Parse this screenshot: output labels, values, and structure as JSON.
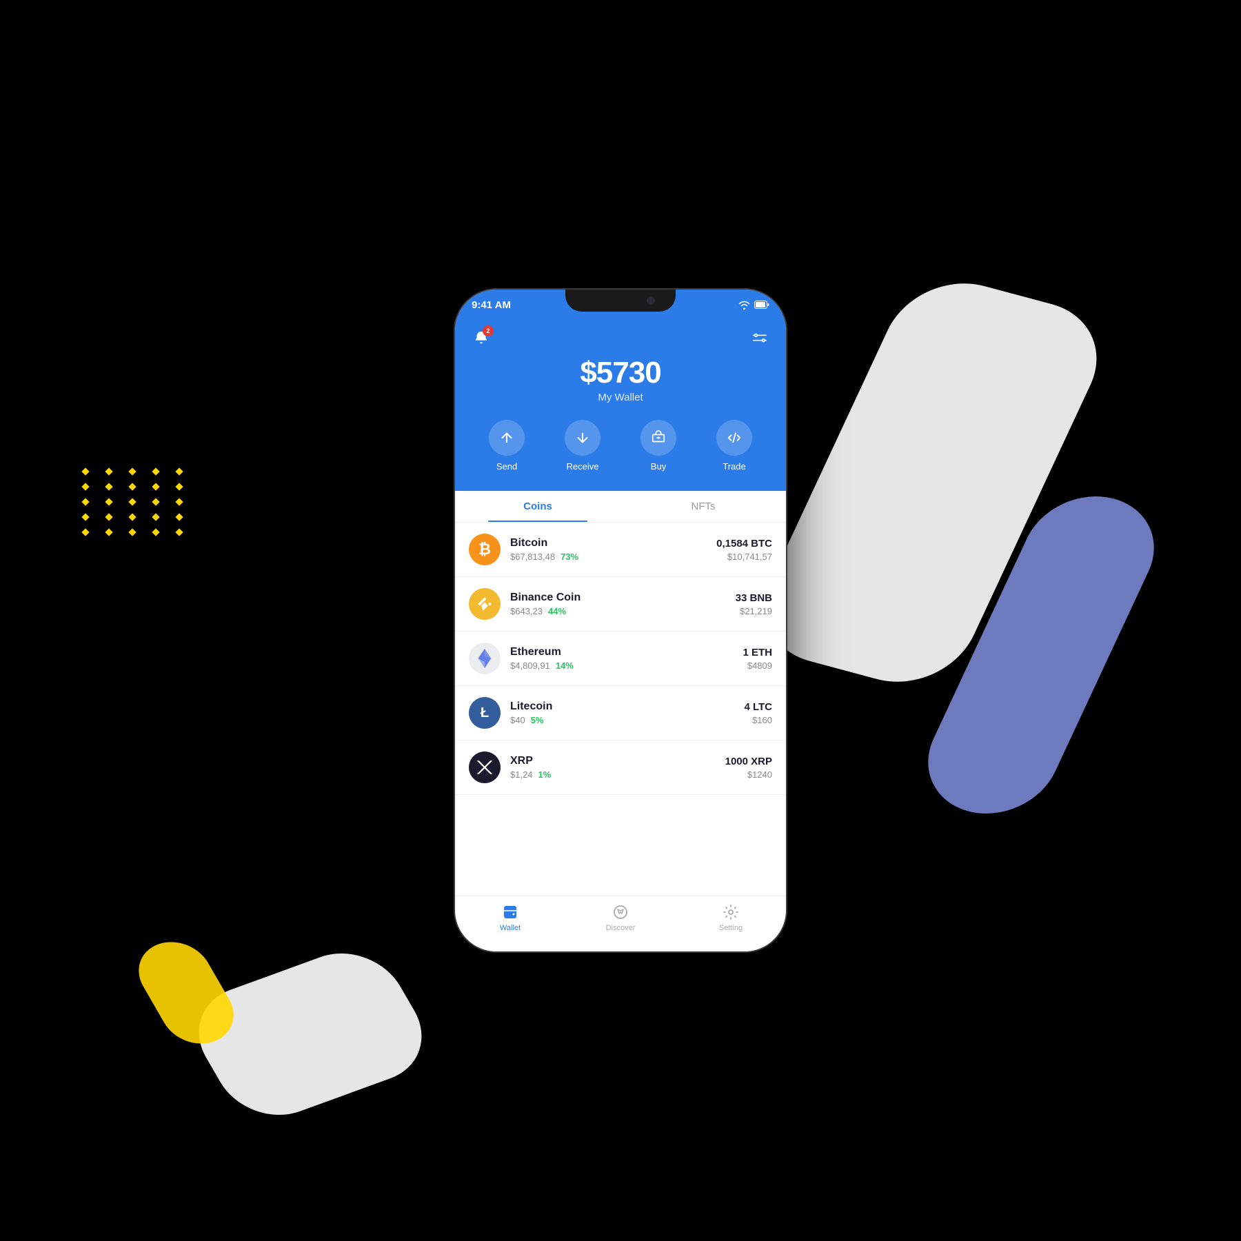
{
  "background": {
    "color": "#000000"
  },
  "status_bar": {
    "time": "9:41 AM",
    "wifi": "wifi",
    "battery": "battery"
  },
  "header": {
    "notification_count": "2",
    "balance": "$5730",
    "wallet_label": "My Wallet"
  },
  "actions": [
    {
      "id": "send",
      "label": "Send",
      "icon": "arrow-up"
    },
    {
      "id": "receive",
      "label": "Receive",
      "icon": "arrow-down"
    },
    {
      "id": "buy",
      "label": "Buy",
      "icon": "tag"
    },
    {
      "id": "trade",
      "label": "Trade",
      "icon": "arrows-swap"
    }
  ],
  "tabs": [
    {
      "id": "coins",
      "label": "Coins",
      "active": true
    },
    {
      "id": "nfts",
      "label": "NFTs",
      "active": false
    }
  ],
  "coins": [
    {
      "id": "btc",
      "name": "Bitcoin",
      "price": "$67,813,48",
      "change": "73%",
      "amount": "0,1584 BTC",
      "value": "$10,741,57",
      "logo_type": "btc",
      "logo_symbol": "₿"
    },
    {
      "id": "bnb",
      "name": "Binance Coin",
      "price": "$643,23",
      "change": "44%",
      "amount": "33 BNB",
      "value": "$21,219",
      "logo_type": "bnb",
      "logo_symbol": "◈"
    },
    {
      "id": "eth",
      "name": "Ethereum",
      "price": "$4,809,91",
      "change": "14%",
      "amount": "1 ETH",
      "value": "$4809",
      "logo_type": "eth",
      "logo_symbol": "♦"
    },
    {
      "id": "ltc",
      "name": "Litecoin",
      "price": "$40",
      "change": "5%",
      "amount": "4 LTC",
      "value": "$160",
      "logo_type": "ltc",
      "logo_symbol": "Ł"
    },
    {
      "id": "xrp",
      "name": "XRP",
      "price": "$1,24",
      "change": "1%",
      "amount": "1000 XRP",
      "value": "$1240",
      "logo_type": "xrp",
      "logo_symbol": "✕"
    }
  ],
  "bottom_nav": [
    {
      "id": "wallet",
      "label": "Wallet",
      "active": true
    },
    {
      "id": "discover",
      "label": "Discover",
      "active": false
    },
    {
      "id": "setting",
      "label": "Setting",
      "active": false
    }
  ],
  "accent_color": "#2B7BE8",
  "green_color": "#22c55e"
}
